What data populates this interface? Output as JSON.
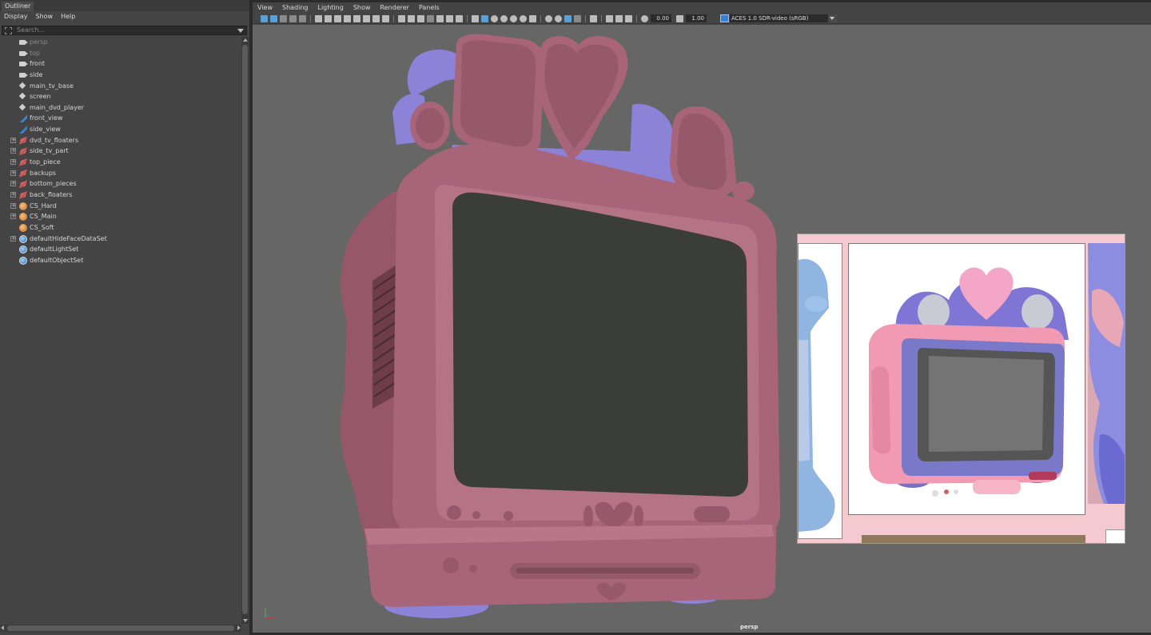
{
  "outliner": {
    "tab_label": "Outliner",
    "menu": [
      "Display",
      "Show",
      "Help"
    ],
    "search_placeholder": "Search...",
    "items": [
      {
        "label": "persp",
        "icon": "camera-icon",
        "expandable": false,
        "dim": true
      },
      {
        "label": "top",
        "icon": "camera-icon",
        "expandable": false,
        "dim": true
      },
      {
        "label": "front",
        "icon": "camera-icon",
        "expandable": false,
        "dim": false
      },
      {
        "label": "side",
        "icon": "camera-icon",
        "expandable": false,
        "dim": false
      },
      {
        "label": "main_tv_base",
        "icon": "transform-icon",
        "expandable": false,
        "dim": false
      },
      {
        "label": "screen",
        "icon": "transform-icon",
        "expandable": false,
        "dim": false
      },
      {
        "label": "main_dvd_player",
        "icon": "transform-icon",
        "expandable": false,
        "dim": false
      },
      {
        "label": "front_view",
        "icon": "image-plane-icon",
        "expandable": false,
        "dim": false
      },
      {
        "label": "side_view",
        "icon": "image-plane-icon",
        "expandable": false,
        "dim": false
      },
      {
        "label": "dvd_tv_floaters",
        "icon": "group-icon",
        "expandable": true,
        "dim": false
      },
      {
        "label": "side_tv_part",
        "icon": "group-icon",
        "expandable": true,
        "dim": false
      },
      {
        "label": "top_piece",
        "icon": "group-icon",
        "expandable": true,
        "dim": false
      },
      {
        "label": "backups",
        "icon": "group-icon",
        "expandable": true,
        "dim": false
      },
      {
        "label": "bottom_pieces",
        "icon": "group-icon",
        "expandable": true,
        "dim": false
      },
      {
        "label": "back_floaters",
        "icon": "group-icon",
        "expandable": true,
        "dim": false
      },
      {
        "label": "CS_Hard",
        "icon": "selection-set-icon",
        "expandable": true,
        "dim": false
      },
      {
        "label": "CS_Main",
        "icon": "selection-set-icon",
        "expandable": true,
        "dim": false
      },
      {
        "label": "CS_Soft",
        "icon": "selection-set-icon",
        "expandable": false,
        "dim": false
      },
      {
        "label": "defaultHideFaceDataSet",
        "icon": "object-set-icon",
        "expandable": true,
        "dim": false
      },
      {
        "label": "defaultLightSet",
        "icon": "object-set-icon",
        "expandable": false,
        "dim": false
      },
      {
        "label": "defaultObjectSet",
        "icon": "object-set-icon",
        "expandable": false,
        "dim": false
      }
    ]
  },
  "viewport": {
    "menu": [
      "View",
      "Shading",
      "Lighting",
      "Show",
      "Renderer",
      "Panels"
    ],
    "exposure_value": "0.00",
    "gamma_value": "1.00",
    "color_space": "ACES 1.0 SDR-video (sRGB)",
    "camera_label": "persp"
  },
  "colors": {
    "model_pink": "#a8657a",
    "model_purple": "#8c83d8",
    "screen_dark": "#3b3d38",
    "viewport_bg": "#666666",
    "accent_blue": "#5aa0d8"
  }
}
